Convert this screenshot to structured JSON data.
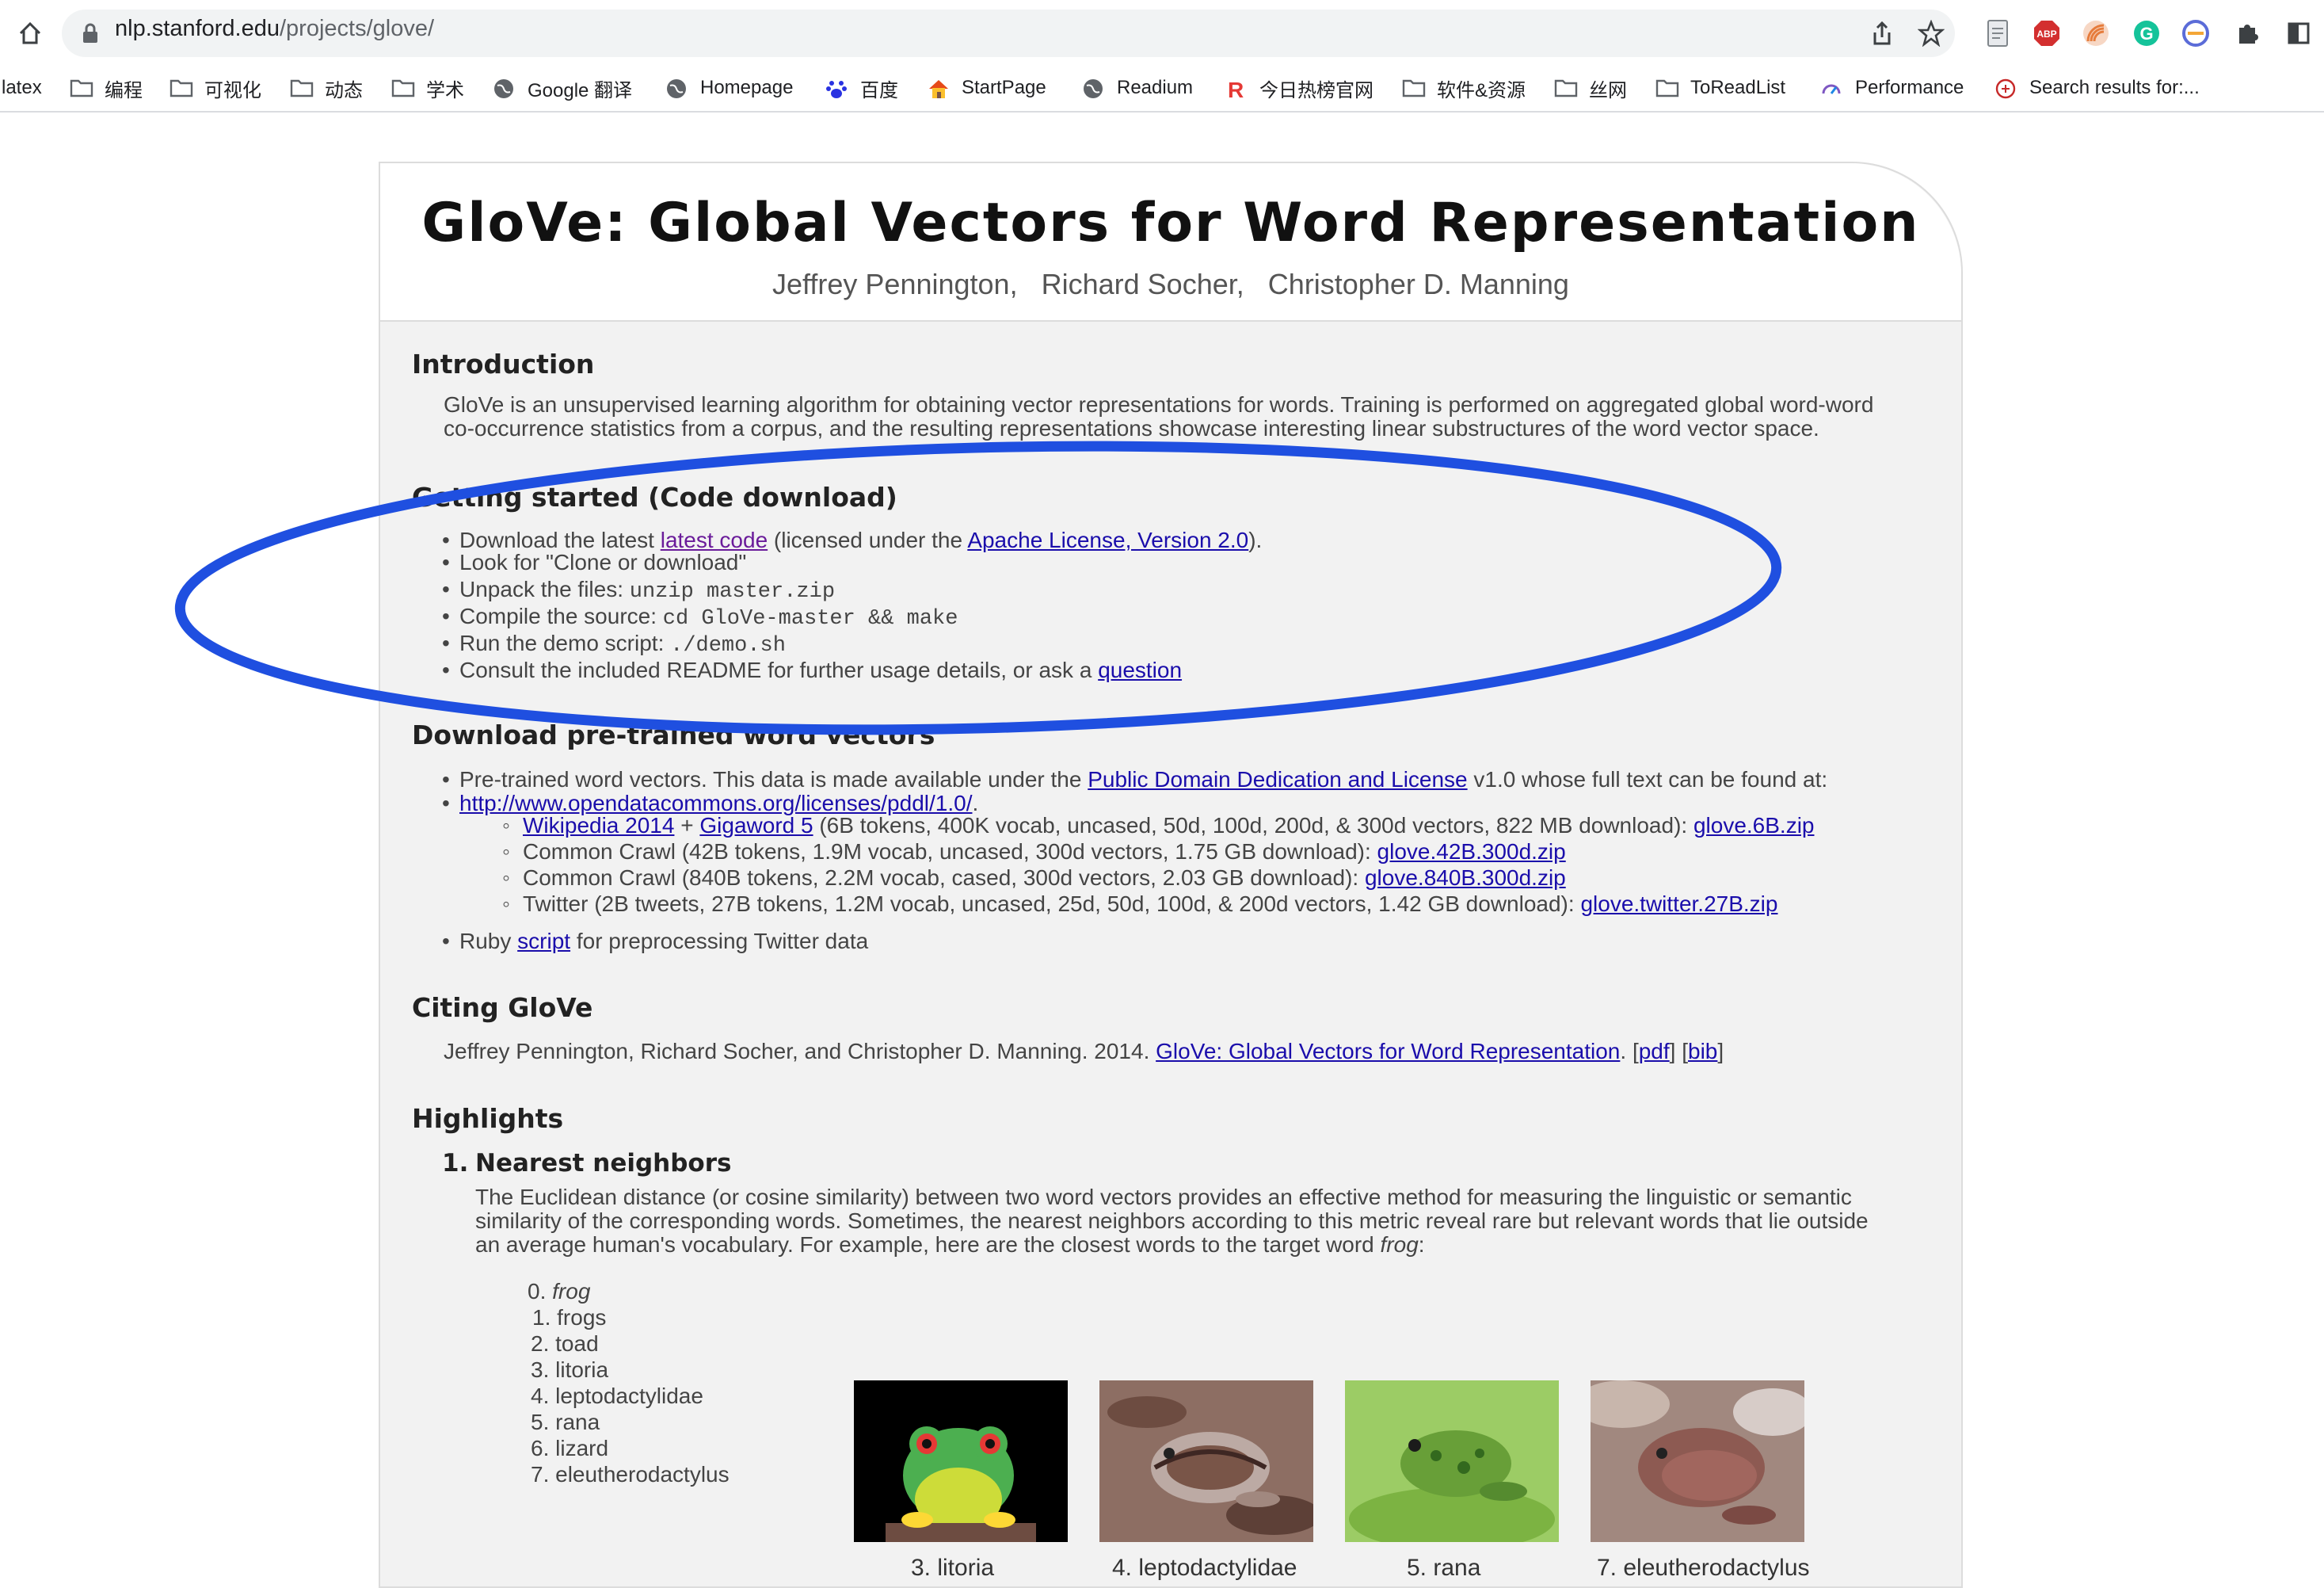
{
  "browser": {
    "url_host": "nlp.stanford.edu",
    "url_path": "/projects/glove/",
    "bookmarks": [
      "latex",
      "编程",
      "可视化",
      "动态",
      "学术",
      "Google 翻译",
      "Homepage",
      "百度",
      "StartPage",
      "Readium",
      "今日热榜官网",
      "软件&资源",
      "丝网",
      "ToReadList",
      "Performance",
      "Search results for:..."
    ]
  },
  "page": {
    "title": "GloVe: Global Vectors for Word Representation",
    "authors": [
      "Jeffrey Pennington,",
      "Richard Socher,",
      "Christopher D. Manning"
    ],
    "intro": {
      "heading": "Introduction",
      "line1": "GloVe is an unsupervised learning algorithm for obtaining vector representations for words. Training is performed on aggregated global word-word",
      "line2": "co-occurrence statistics from a corpus, and the resulting representations showcase interesting linear substructures of the word vector space."
    },
    "getting_started": {
      "heading": "Getting started (Code download)",
      "dl_pre": "Download the latest ",
      "dl_link": "latest code",
      "dl_mid": " (licensed under the ",
      "license_link": "Apache License, Version 2.0",
      "dl_post": ").",
      "dl_line2": "Look for \"Clone or download\"",
      "unpack_pre": "Unpack the files: ",
      "unpack_cmd": "unzip master.zip",
      "compile_pre": "Compile the source: ",
      "compile_cmd": "cd GloVe-master && make",
      "demo_pre": "Run the demo script: ",
      "demo_cmd": "./demo.sh",
      "consult_pre": "Consult the included README for further usage details, or ask a ",
      "question_link": "question"
    },
    "pretrained": {
      "heading": "Download pre-trained word vectors",
      "desc_pre": "Pre-trained word vectors. This data is made available under the ",
      "pddl_link": "Public Domain Dedication and License",
      "desc_post": " v1.0 whose full text can be found at:",
      "pddl_url": "http://www.opendatacommons.org/licenses/pddl/1.0/",
      "pddl_url_post": ".",
      "wiki_link": "Wikipedia 2014",
      "plus": " + ",
      "gigaword_link": "Gigaword 5",
      "wiki_desc": " (6B tokens, 400K vocab, uncased, 50d, 100d, 200d, & 300d vectors, 822 MB download): ",
      "wiki_file": "glove.6B.zip",
      "cc42_desc": "Common Crawl (42B tokens, 1.9M vocab, uncased, 300d vectors, 1.75 GB download): ",
      "cc42_file": "glove.42B.300d.zip",
      "cc840_desc": "Common Crawl (840B tokens, 2.2M vocab, cased, 300d vectors, 2.03 GB download): ",
      "cc840_file": "glove.840B.300d.zip",
      "tw_desc": "Twitter (2B tweets, 27B tokens, 1.2M vocab, uncased, 25d, 50d, 100d, & 200d vectors, 1.42 GB download): ",
      "tw_file": "glove.twitter.27B.zip",
      "ruby_pre": "Ruby ",
      "ruby_link": "script",
      "ruby_post": " for preprocessing Twitter data"
    },
    "citing": {
      "heading": "Citing GloVe",
      "text": "Jeffrey Pennington, Richard Socher, and Christopher D. Manning. 2014. ",
      "paper_link": "GloVe: Global Vectors for Word Representation",
      "sep1": ". [",
      "pdf_link": "pdf",
      "sep2": "] [",
      "bib_link": "bib",
      "sep3": "]"
    },
    "highlights": {
      "heading": "Highlights",
      "item_num": "1.",
      "item_title": "Nearest neighbors",
      "line1": "The Euclidean distance (or cosine similarity) between two word vectors provides an effective method for measuring the linguistic or semantic",
      "line2": "similarity of the corresponding words. Sometimes, the nearest neighbors according to this metric reveal rare but relevant words that lie outside",
      "line3_pre": "an average human's vocabulary. For example, here are the closest words to the target word ",
      "line3_word": "frog",
      "line3_post": ":",
      "neighbors": [
        {
          "num": "0.",
          "word": "frog"
        },
        {
          "num": "1.",
          "word": "frogs"
        },
        {
          "num": "2.",
          "word": "toad"
        },
        {
          "num": "3.",
          "word": "litoria"
        },
        {
          "num": "4.",
          "word": "leptodactylidae"
        },
        {
          "num": "5.",
          "word": "rana"
        },
        {
          "num": "6.",
          "word": "lizard"
        },
        {
          "num": "7.",
          "word": "eleutherodactylus"
        }
      ],
      "captions": [
        "3. litoria",
        "4. leptodactylidae",
        "5. rana",
        "7. eleutherodactylus"
      ]
    }
  },
  "colors": {
    "annotation_ellipse": "#1f4fe0",
    "link": "#1a0dab",
    "visited_link": "#6a1b9a"
  }
}
